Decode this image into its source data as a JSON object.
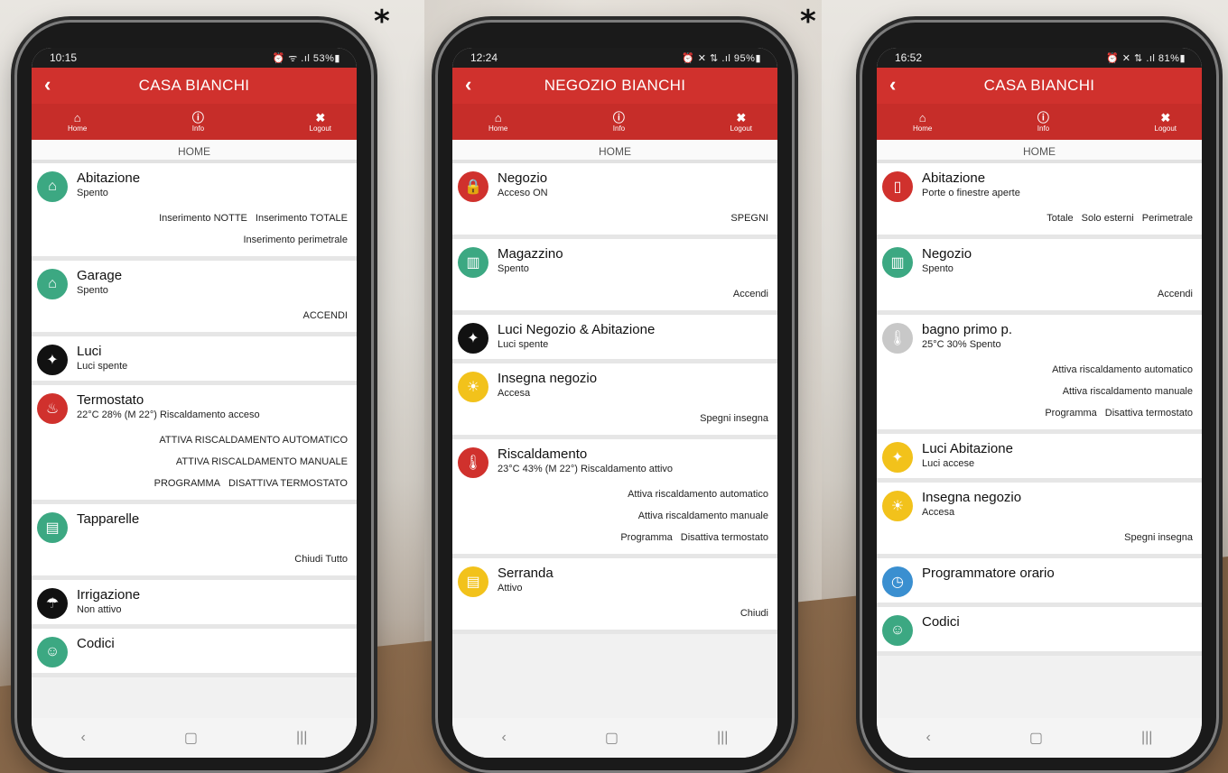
{
  "stars": [
    "*",
    "*"
  ],
  "phones": [
    {
      "status": {
        "time": "10:15",
        "indicators": "⏰ ᯤ .ıl 53%▮"
      },
      "title": "CASA BIANCHI",
      "nav": {
        "home": "Home",
        "info": "Info",
        "logout": "Logout"
      },
      "section": "HOME",
      "items": [
        {
          "name": "Abitazione",
          "sub": "Spento",
          "icon": "home-icon",
          "color": "#3ca882",
          "actions": [
            [
              "Inserimento NOTTE",
              "Inserimento TOTALE"
            ],
            [
              "Inserimento perimetrale"
            ]
          ]
        },
        {
          "name": "Garage",
          "sub": "Spento",
          "icon": "garage-icon",
          "color": "#3ca882",
          "actions": [
            [
              "ACCENDI"
            ]
          ]
        },
        {
          "name": "Luci",
          "sub": "Luci spente",
          "icon": "bulb-icon",
          "color": "#111111",
          "actions": []
        },
        {
          "name": "Termostato",
          "sub": "22°C 28% (M 22°) Riscaldamento acceso",
          "icon": "flame-icon",
          "color": "#d0312d",
          "actions": [
            [
              "ATTIVA RISCALDAMENTO AUTOMATICO"
            ],
            [
              "ATTIVA RISCALDAMENTO MANUALE"
            ],
            [
              "PROGRAMMA",
              "DISATTIVA TERMOSTATO"
            ]
          ]
        },
        {
          "name": "Tapparelle",
          "sub": "",
          "icon": "shutter-icon",
          "color": "#3ca882",
          "actions": [
            [
              "Chiudi Tutto"
            ]
          ]
        },
        {
          "name": "Irrigazione",
          "sub": "Non attivo",
          "icon": "watering-icon",
          "color": "#111111",
          "actions": []
        },
        {
          "name": "Codici",
          "sub": "",
          "icon": "user-icon",
          "color": "#3ca882",
          "actions": []
        }
      ]
    },
    {
      "status": {
        "time": "12:24",
        "indicators": "⏰ ✕ ⇅ .ıl 95%▮"
      },
      "title": "NEGOZIO BIANCHI",
      "nav": {
        "home": "Home",
        "info": "Info",
        "logout": "Logout"
      },
      "section": "HOME",
      "items": [
        {
          "name": "Negozio",
          "sub": "Acceso ON",
          "icon": "lock-icon",
          "color": "#d0312d",
          "actions": [
            [
              "SPEGNI"
            ]
          ]
        },
        {
          "name": "Magazzino",
          "sub": "Spento",
          "icon": "factory-icon",
          "color": "#3ca882",
          "actions": [
            [
              "Accendi"
            ]
          ]
        },
        {
          "name": "Luci Negozio & Abitazione",
          "sub": "Luci spente",
          "icon": "bulb-icon",
          "color": "#111111",
          "actions": []
        },
        {
          "name": "Insegna negozio",
          "sub": "Accesa",
          "icon": "sign-icon",
          "color": "#f2c21b",
          "actions": [
            [
              "Spegni insegna"
            ]
          ]
        },
        {
          "name": "Riscaldamento",
          "sub": "23°C 43% (M 22°) Riscaldamento attivo",
          "icon": "thermometer-icon",
          "color": "#d0312d",
          "actions": [
            [
              "Attiva riscaldamento automatico"
            ],
            [
              "Attiva riscaldamento manuale"
            ],
            [
              "Programma",
              "Disattiva termostato"
            ]
          ]
        },
        {
          "name": "Serranda",
          "sub": "Attivo",
          "icon": "shutter-icon",
          "color": "#f2c21b",
          "actions": [
            [
              "Chiudi"
            ]
          ]
        }
      ]
    },
    {
      "status": {
        "time": "16:52",
        "indicators": "⏰ ✕ ⇅ .ıl 81%▮"
      },
      "title": "CASA BIANCHI",
      "nav": {
        "home": "Home",
        "info": "Info",
        "logout": "Logout"
      },
      "section": "HOME",
      "items": [
        {
          "name": "Abitazione",
          "sub": "Porte o finestre aperte",
          "icon": "door-icon",
          "color": "#d0312d",
          "actions": [
            [
              "Totale",
              "Solo esterni",
              "Perimetrale"
            ]
          ]
        },
        {
          "name": "Negozio",
          "sub": "Spento",
          "icon": "factory-icon",
          "color": "#3ca882",
          "actions": [
            [
              "Accendi"
            ]
          ]
        },
        {
          "name": "bagno primo p.",
          "sub": "25°C 30% Spento",
          "icon": "thermometer-icon",
          "color": "#c8c8c8",
          "actions": [
            [
              "Attiva riscaldamento automatico"
            ],
            [
              "Attiva riscaldamento manuale"
            ],
            [
              "Programma",
              "Disattiva termostato"
            ]
          ]
        },
        {
          "name": "Luci Abitazione",
          "sub": "Luci accese",
          "icon": "bulb-icon",
          "color": "#f2c21b",
          "actions": []
        },
        {
          "name": "Insegna negozio",
          "sub": "Accesa",
          "icon": "sign-icon",
          "color": "#f2c21b",
          "actions": [
            [
              "Spegni insegna"
            ]
          ]
        },
        {
          "name": "Programmatore orario",
          "sub": "",
          "icon": "clock-icon",
          "color": "#3a8fd0",
          "actions": []
        },
        {
          "name": "Codici",
          "sub": "",
          "icon": "user-icon",
          "color": "#3ca882",
          "actions": []
        }
      ]
    }
  ]
}
